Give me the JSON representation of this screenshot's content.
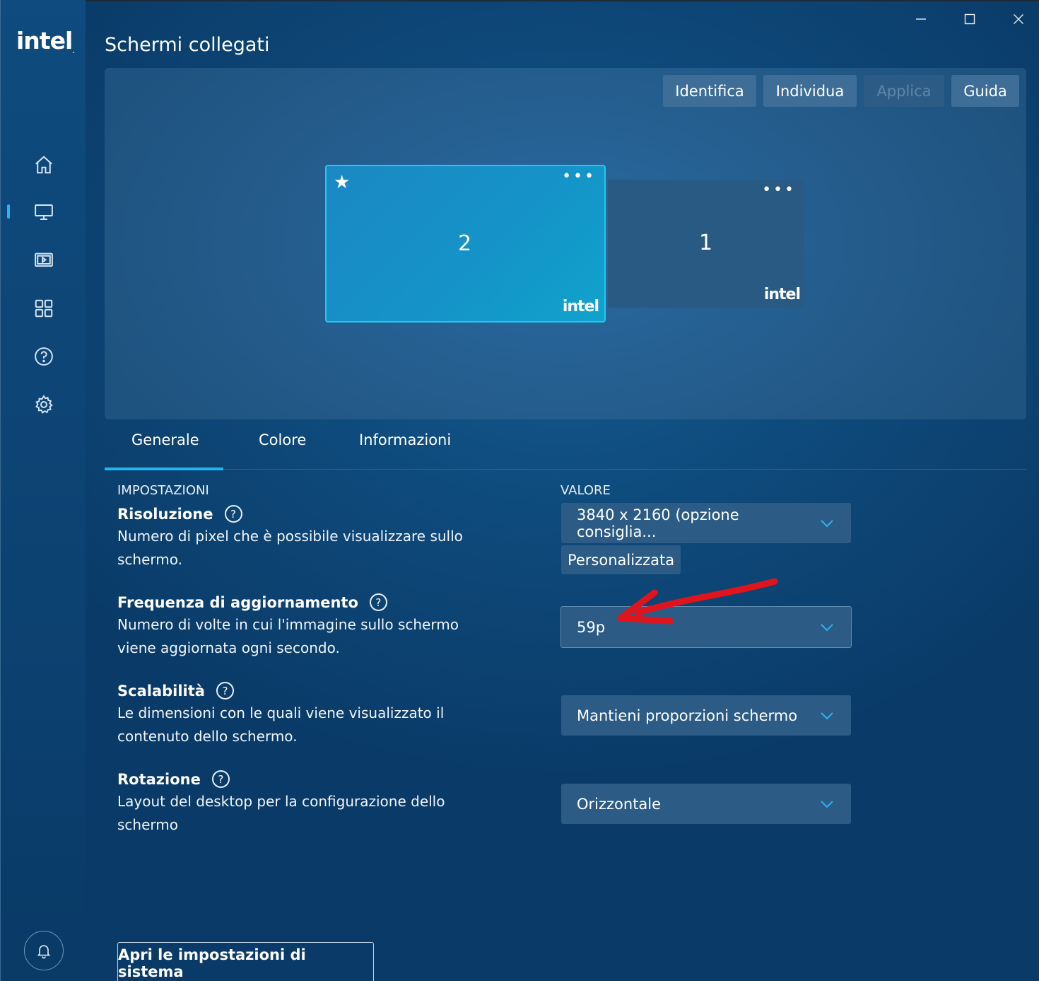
{
  "app": {
    "logo": "intel",
    "logo_mark": ".",
    "page_title": "Schermi collegati"
  },
  "sidebar": {
    "items": [
      {
        "name": "home",
        "icon": "home-icon"
      },
      {
        "name": "display",
        "icon": "monitor-icon",
        "active": true
      },
      {
        "name": "video",
        "icon": "video-icon"
      },
      {
        "name": "apps",
        "icon": "grid-icon"
      },
      {
        "name": "help",
        "icon": "help-icon"
      },
      {
        "name": "settings",
        "icon": "gear-icon"
      }
    ],
    "notifications_icon": "bell-icon"
  },
  "window_controls": [
    "minimize-icon",
    "maximize-icon",
    "close-icon"
  ],
  "toolbar": {
    "identify": "Identifica",
    "locate": "Individua",
    "apply": "Applica",
    "guide": "Guida"
  },
  "displays": [
    {
      "number": "2",
      "primary": true,
      "brand": "intel",
      "menu": "•••"
    },
    {
      "number": "1",
      "primary": false,
      "brand": "intel",
      "menu": "•••"
    }
  ],
  "tabs": [
    "Generale",
    "Colore",
    "Informazioni"
  ],
  "columns": {
    "settings": "IMPOSTAZIONI",
    "value": "VALORE"
  },
  "settings": [
    {
      "title": "Risoluzione",
      "desc": "Numero di pixel che è possibile visualizzare sullo schermo.",
      "value": "3840 x 2160 (opzione consiglia...",
      "extra_button": "Personalizzata"
    },
    {
      "title": "Frequenza di aggiornamento",
      "desc": "Numero di volte in cui l'immagine sullo schermo viene aggiornata ogni secondo.",
      "value": "59p"
    },
    {
      "title": "Scalabilità",
      "desc": "Le dimensioni con le quali viene visualizzato il contenuto dello schermo.",
      "value": "Mantieni proporzioni schermo"
    },
    {
      "title": "Rotazione",
      "desc": "Layout del desktop per la configurazione dello schermo",
      "value": "Orizzontale"
    }
  ],
  "help_glyph": "?",
  "footer": {
    "system_settings": "Apri le impostazioni di sistema"
  },
  "colors": {
    "accent": "#2ab3f2",
    "annotation_arrow": "#e0141c"
  }
}
